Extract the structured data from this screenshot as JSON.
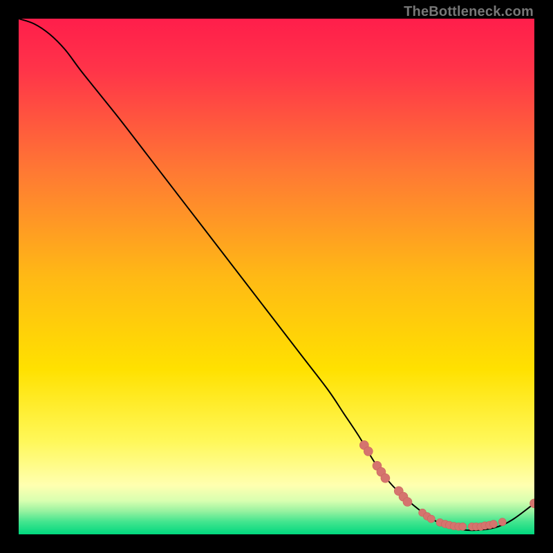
{
  "watermark": "TheBottleneck.com",
  "colors": {
    "bg": "#000000",
    "grad_top": "#ff1e4b",
    "grad_yellow_mid": "#ffd000",
    "grad_yellow_light": "#ffff8a",
    "grad_green_band_top": "#cfffab",
    "grad_green_band_bot": "#00e27a",
    "curve": "#000000",
    "dot_fill": "#d5746e",
    "dot_stroke": "#c9635d"
  },
  "chart_data": {
    "type": "line",
    "title": "",
    "xlabel": "",
    "ylabel": "",
    "xlim": [
      0,
      100
    ],
    "ylim": [
      0,
      100
    ],
    "curve": [
      {
        "x": 0,
        "y": 100
      },
      {
        "x": 3,
        "y": 99
      },
      {
        "x": 6,
        "y": 97
      },
      {
        "x": 9,
        "y": 94
      },
      {
        "x": 12,
        "y": 90
      },
      {
        "x": 16,
        "y": 85
      },
      {
        "x": 20,
        "y": 80
      },
      {
        "x": 25,
        "y": 73.5
      },
      {
        "x": 30,
        "y": 67
      },
      {
        "x": 35,
        "y": 60.5
      },
      {
        "x": 40,
        "y": 54
      },
      {
        "x": 45,
        "y": 47.5
      },
      {
        "x": 50,
        "y": 41
      },
      {
        "x": 55,
        "y": 34.5
      },
      {
        "x": 60,
        "y": 28
      },
      {
        "x": 63,
        "y": 23.5
      },
      {
        "x": 66,
        "y": 19
      },
      {
        "x": 69,
        "y": 14
      },
      {
        "x": 72,
        "y": 10
      },
      {
        "x": 75,
        "y": 7
      },
      {
        "x": 78,
        "y": 4.5
      },
      {
        "x": 81,
        "y": 2.5
      },
      {
        "x": 84,
        "y": 1.3
      },
      {
        "x": 87,
        "y": 0.8
      },
      {
        "x": 90,
        "y": 0.9
      },
      {
        "x": 93,
        "y": 1.5
      },
      {
        "x": 96,
        "y": 3
      },
      {
        "x": 100,
        "y": 6
      }
    ],
    "upper_dots": [
      {
        "x": 67.0,
        "y": 17.3
      },
      {
        "x": 67.8,
        "y": 16.1
      },
      {
        "x": 69.5,
        "y": 13.3
      },
      {
        "x": 70.3,
        "y": 12.1
      },
      {
        "x": 71.1,
        "y": 10.9
      },
      {
        "x": 73.7,
        "y": 8.4
      },
      {
        "x": 74.6,
        "y": 7.3
      },
      {
        "x": 75.4,
        "y": 6.3
      }
    ],
    "bottom_dots": [
      {
        "x": 78.3,
        "y": 4.2
      },
      {
        "x": 79.2,
        "y": 3.5
      },
      {
        "x": 80.0,
        "y": 3.0
      },
      {
        "x": 81.7,
        "y": 2.3
      },
      {
        "x": 82.7,
        "y": 2.0
      },
      {
        "x": 83.5,
        "y": 1.8
      },
      {
        "x": 84.4,
        "y": 1.6
      },
      {
        "x": 85.3,
        "y": 1.5
      },
      {
        "x": 86.1,
        "y": 1.5
      },
      {
        "x": 87.9,
        "y": 1.5
      },
      {
        "x": 88.7,
        "y": 1.5
      },
      {
        "x": 89.6,
        "y": 1.5
      },
      {
        "x": 90.4,
        "y": 1.7
      },
      {
        "x": 91.3,
        "y": 1.8
      },
      {
        "x": 92.1,
        "y": 2.0
      },
      {
        "x": 93.8,
        "y": 2.4
      }
    ],
    "end_dot": {
      "x": 100,
      "y": 6
    },
    "bottom_label": {
      "text": "",
      "x": 85,
      "y": 2.2
    }
  }
}
